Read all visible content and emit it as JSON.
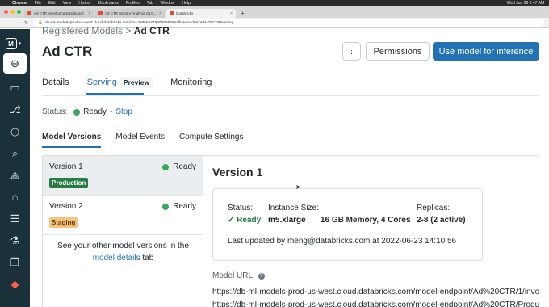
{
  "menubar": {
    "items": [
      "Chrome",
      "File",
      "Edit",
      "View",
      "History",
      "Bookmarks",
      "Profiles",
      "Tab",
      "Window",
      "Help"
    ],
    "clock": "Wed Jun 29 8:47 AM"
  },
  "browser": {
    "tabs": [
      {
        "label": "Ad CTR Monitoring Dashboard"
      },
      {
        "label": "Ad CTR Monitor Analysis DLT Pipeli..."
      },
      {
        "label": "Databricks"
      }
    ],
    "url": "db-ml-models-prod-us-west.cloud.databricks.com/?o=3866667496058990#mlflow/models/Ad%20CTR/serving"
  },
  "leftnav": {
    "workspace_letter": "M"
  },
  "breadcrumb": {
    "parent": "Registered Models",
    "sep": ">",
    "current": "Ad CTR"
  },
  "page": {
    "title": "Ad CTR"
  },
  "actions": {
    "kebab": "⋮",
    "permissions": "Permissions",
    "use_model": "Use model for inference"
  },
  "tabs": [
    {
      "label": "Details"
    },
    {
      "label": "Serving",
      "badge": "Preview"
    },
    {
      "label": "Monitoring"
    }
  ],
  "status": {
    "label": "Status:",
    "value": "Ready",
    "separator": "-",
    "action": "Stop"
  },
  "subtabs": [
    {
      "label": "Model Versions"
    },
    {
      "label": "Model Events"
    },
    {
      "label": "Compute Settings"
    }
  ],
  "versions": [
    {
      "name": "Version 1",
      "status": "Ready",
      "stage": "Production"
    },
    {
      "name": "Version 2",
      "status": "Ready",
      "stage": "Staging"
    }
  ],
  "versions_note": {
    "line1": "See your other model versions in the",
    "link": "model details",
    "suffix": "tab"
  },
  "detail": {
    "title": "Version 1",
    "status_h": "Status:",
    "status_v": "Ready",
    "instance_h": "Instance Size:",
    "instance_type": "m5.xlarge",
    "instance_spec": "16 GB Memory, 4 Cores",
    "replicas_h": "Replicas:",
    "replicas_v": "2-8 (2 active)",
    "updated": "Last updated by meng@databricks.com at 2022-06-23 14:10:56",
    "url_label": "Model URL:",
    "url_lines": [
      "https://db-ml-models-prod-us-west.cloud.databricks.com/model-endpoint/Ad%20CTR/1/invoc",
      "https://db-ml-models-prod-us-west.cloud.databricks.com/model-endpoint/Ad%20CTR/Produ"
    ]
  },
  "colors": {
    "accent": "#2272b4",
    "nav_bg": "#1b3139",
    "ready": "#3ba65e",
    "production": "#277c43",
    "staging": "#f7c27d"
  }
}
